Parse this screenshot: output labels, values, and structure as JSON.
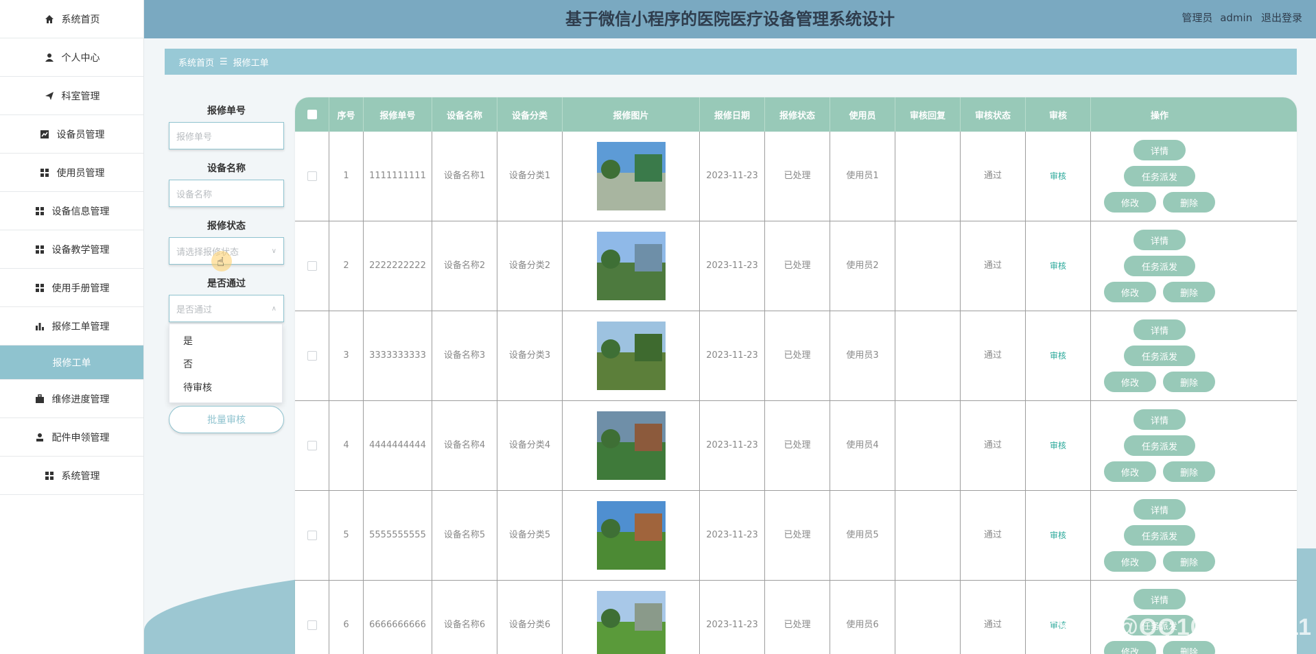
{
  "header": {
    "title": "基于微信小程序的医院医疗设备管理系统设计",
    "role": "管理员",
    "username": "admin",
    "logout": "退出登录",
    "color": "#7aa9c1"
  },
  "sidebar": {
    "items": [
      {
        "label": "系统首页",
        "icon": "home-icon"
      },
      {
        "label": "个人中心",
        "icon": "user-icon"
      },
      {
        "label": "科室管理",
        "icon": "send-icon"
      },
      {
        "label": "设备员管理",
        "icon": "chart-icon"
      },
      {
        "label": "使用员管理",
        "icon": "grid-icon"
      },
      {
        "label": "设备信息管理",
        "icon": "grid-icon"
      },
      {
        "label": "设备教学管理",
        "icon": "grid-icon"
      },
      {
        "label": "使用手册管理",
        "icon": "grid-icon"
      },
      {
        "label": "报修工单管理",
        "icon": "bar-chart-icon"
      },
      {
        "label": "报修工单",
        "active": true
      },
      {
        "label": "维修进度管理",
        "icon": "briefcase-icon"
      },
      {
        "label": "配件申领管理",
        "icon": "user-icon"
      },
      {
        "label": "系统管理",
        "icon": "grid-icon"
      }
    ],
    "active_color": "#8fc3cf"
  },
  "breadcrumb": {
    "home": "系统首页",
    "sep": "☰",
    "current": "报修工单"
  },
  "search": {
    "f1_label": "报修单号",
    "f1_placeholder": "报修单号",
    "f2_label": "设备名称",
    "f2_placeholder": "设备名称",
    "f3_label": "报修状态",
    "f3_placeholder": "请选择报修状态",
    "f4_label": "是否通过",
    "f4_placeholder": "是否通过",
    "options": [
      "是",
      "否",
      "待审核"
    ],
    "batch_button": "批量审核"
  },
  "table": {
    "headers": [
      "序号",
      "报修单号",
      "设备名称",
      "设备分类",
      "报修图片",
      "报修日期",
      "报修状态",
      "使用员",
      "审核回复",
      "审核状态",
      "审核",
      "操作"
    ],
    "rows": [
      {
        "no": "1",
        "order": "1111111111",
        "device": "设备名称1",
        "category": "设备分类1",
        "date": "2023-11-23",
        "status": "已处理",
        "user": "使用员1",
        "reply": "",
        "audit_status": "通过",
        "audit": "审核"
      },
      {
        "no": "2",
        "order": "2222222222",
        "device": "设备名称2",
        "category": "设备分类2",
        "date": "2023-11-23",
        "status": "已处理",
        "user": "使用员2",
        "reply": "",
        "audit_status": "通过",
        "audit": "审核"
      },
      {
        "no": "3",
        "order": "3333333333",
        "device": "设备名称3",
        "category": "设备分类3",
        "date": "2023-11-23",
        "status": "已处理",
        "user": "使用员3",
        "reply": "",
        "audit_status": "通过",
        "audit": "审核"
      },
      {
        "no": "4",
        "order": "4444444444",
        "device": "设备名称4",
        "category": "设备分类4",
        "date": "2023-11-23",
        "status": "已处理",
        "user": "使用员4",
        "reply": "",
        "audit_status": "通过",
        "audit": "审核"
      },
      {
        "no": "5",
        "order": "5555555555",
        "device": "设备名称5",
        "category": "设备分类5",
        "date": "2023-11-23",
        "status": "已处理",
        "user": "使用员5",
        "reply": "",
        "audit_status": "通过",
        "audit": "审核"
      },
      {
        "no": "6",
        "order": "6666666666",
        "device": "设备名称6",
        "category": "设备分类6",
        "date": "2023-11-23",
        "status": "已处理",
        "user": "使用员6",
        "reply": "",
        "audit_status": "通过",
        "audit": "审核"
      }
    ],
    "ops": {
      "detail": "详情",
      "dispatch": "任务派发",
      "edit": "修改",
      "delete": "删除"
    },
    "header_color": "#98c9b8"
  },
  "watermark": "CSDN @QQ1039692211"
}
